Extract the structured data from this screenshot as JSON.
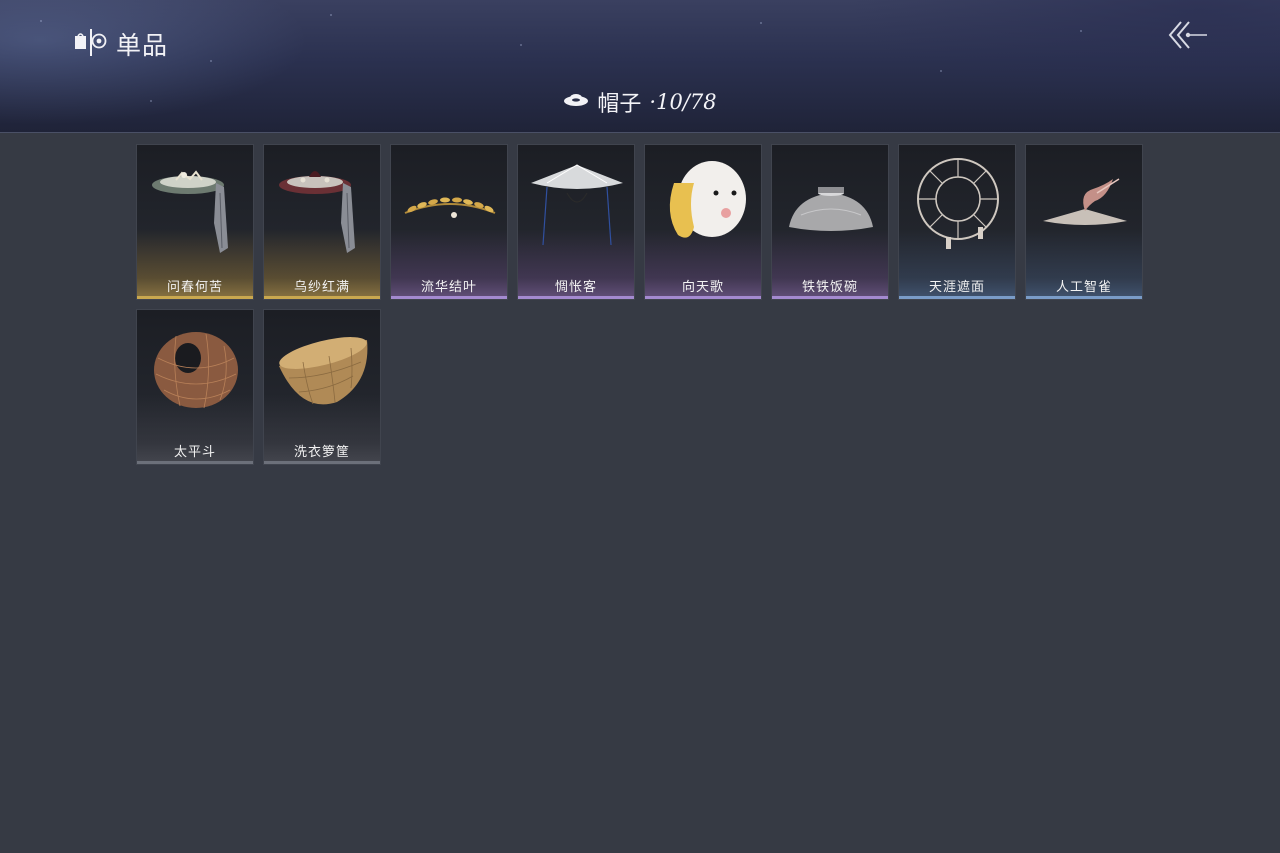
{
  "header": {
    "page_title": "单品",
    "category_name": "帽子",
    "category_count": "·10/78",
    "icons": {
      "title": "wardrobe-icon",
      "category": "hat-icon",
      "back": "back-arrow-icon"
    }
  },
  "items": [
    {
      "name": "问春何苦",
      "rarity": "gold",
      "icon": "veiled-hat-icon"
    },
    {
      "name": "乌纱红满",
      "rarity": "gold",
      "icon": "veiled-hat-red-icon"
    },
    {
      "name": "流华结叶",
      "rarity": "purple",
      "icon": "laurel-wreath-icon"
    },
    {
      "name": "惆怅客",
      "rarity": "purple",
      "icon": "bamboo-hat-icon"
    },
    {
      "name": "向天歌",
      "rarity": "purple",
      "icon": "duck-hood-icon"
    },
    {
      "name": "铁铁饭碗",
      "rarity": "purple",
      "icon": "iron-bowl-icon"
    },
    {
      "name": "天涯遮面",
      "rarity": "blue",
      "icon": "wheel-hat-icon"
    },
    {
      "name": "人工智雀",
      "rarity": "blue",
      "icon": "bird-hat-icon"
    },
    {
      "name": "太平斗",
      "rarity": "gray",
      "icon": "woven-cone-icon"
    },
    {
      "name": "洗衣箩筐",
      "rarity": "gray",
      "icon": "laundry-basket-icon"
    }
  ],
  "colors": {
    "background": "#363a44",
    "gold": "#c9a84f",
    "purple": "#a48ad0",
    "blue": "#7a9cc8",
    "gray": "#6c707a"
  }
}
